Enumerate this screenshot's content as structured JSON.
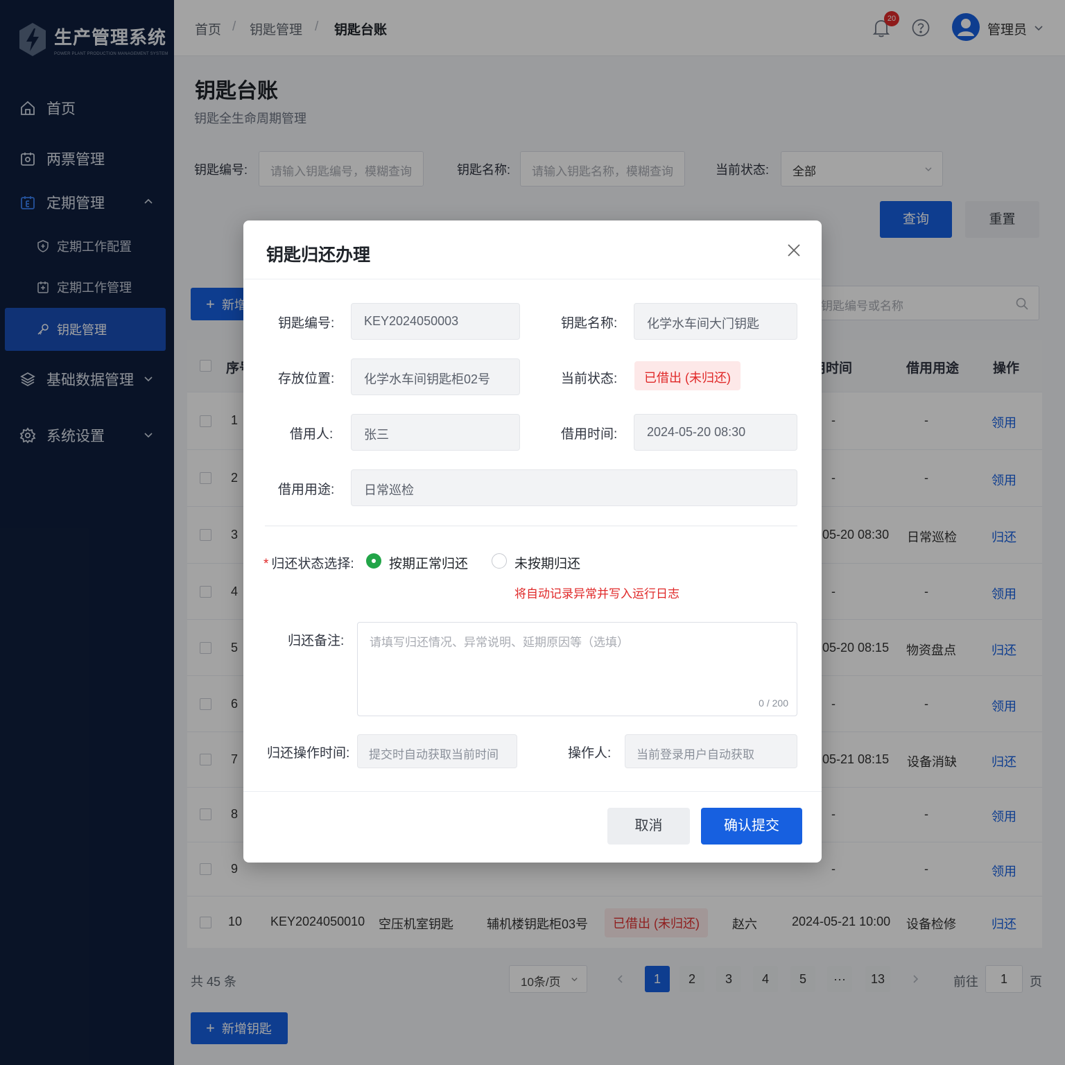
{
  "colors": {
    "sidebar_bg": "#0f1f3d",
    "primary": "#1760e0",
    "danger": "#e02929",
    "success": "#22a548"
  },
  "brand": {
    "title": "生产管理系统",
    "subtitle": "POWER PLANT PRODUCTION MANAGEMENT SYSTEM"
  },
  "sidebar": {
    "items": [
      {
        "label": "首页",
        "icon": "home-icon"
      },
      {
        "label": "两票管理",
        "icon": "ticket-icon"
      },
      {
        "label": "定期管理",
        "icon": "calendar-icon",
        "expanded": true,
        "children": [
          {
            "label": "定期工作配置",
            "icon": "shield-icon"
          },
          {
            "label": "定期工作管理",
            "icon": "calendar-check-icon"
          },
          {
            "label": "钥匙管理",
            "icon": "key-icon",
            "active": true
          }
        ]
      },
      {
        "label": "基础数据管理",
        "icon": "database-icon"
      },
      {
        "label": "系统设置",
        "icon": "gear-icon"
      }
    ]
  },
  "header": {
    "breadcrumb": [
      "首页",
      "钥匙管理",
      "钥匙台账"
    ],
    "separator": "/",
    "notification_count": "20",
    "user_name": "管理员"
  },
  "page": {
    "title": "钥匙台账",
    "subtitle": "钥匙全生命周期管理"
  },
  "filters": {
    "key_no_label": "钥匙编号:",
    "key_no_placeholder": "请输入钥匙编号，模糊查询",
    "key_name_label": "钥匙名称:",
    "key_name_placeholder": "请输入钥匙名称，模糊查询",
    "status_label": "当前状态:",
    "status_value": "全部",
    "query_btn": "查询",
    "reset_btn": "重置"
  },
  "toolbar": {
    "add_label": "新增钥匙",
    "add_label_partial": "新增",
    "search_placeholder": "钥匙编号或名称"
  },
  "table": {
    "headers": {
      "index": "序号",
      "borrow_time": "借用时间",
      "purpose": "借用用途",
      "action": "操作"
    },
    "headers_partial": {
      "index": "序号",
      "borrow_time": "用时间"
    },
    "rows": [
      {
        "index": "1",
        "time": "-",
        "purpose": "-",
        "action": "领用"
      },
      {
        "index": "2",
        "time": "-",
        "purpose": "-",
        "action": "领用"
      },
      {
        "index": "3",
        "time": "05-20 08:30",
        "purpose": "日常巡检",
        "action": "归还"
      },
      {
        "index": "4",
        "time": "-",
        "purpose": "-",
        "action": "领用"
      },
      {
        "index": "5",
        "time": "05-20 08:15",
        "purpose": "物资盘点",
        "action": "归还"
      },
      {
        "index": "6",
        "time": "-",
        "purpose": "-",
        "action": "领用"
      },
      {
        "index": "7",
        "time": "05-21 08:15",
        "purpose": "设备消缺",
        "action": "归还"
      },
      {
        "index": "8",
        "time": "-",
        "purpose": "-",
        "action": "领用"
      },
      {
        "index": "9",
        "time": "-",
        "purpose": "-",
        "action": "领用"
      },
      {
        "index": "10",
        "key_no": "KEY2024050010",
        "name": "空压机室钥匙",
        "location": "辅机楼钥匙柜03号",
        "status": "已借出 (未归还)",
        "borrower": "赵六",
        "time": "2024-05-21 10:00",
        "purpose": "设备检修",
        "action": "归还"
      }
    ]
  },
  "pagination": {
    "total": "共 45 条",
    "page_size": "10条/页",
    "pages": [
      "1",
      "2",
      "3",
      "4",
      "5",
      "···",
      "13"
    ],
    "current": "1",
    "goto_label": "前往",
    "goto_value": "1",
    "page_suffix": "页"
  },
  "modal": {
    "title": "钥匙归还办理",
    "key_no_label": "钥匙编号:",
    "key_no": "KEY2024050003",
    "key_name_label": "钥匙名称:",
    "key_name": "化学水车间大门钥匙",
    "location_label": "存放位置:",
    "location": "化学水车间钥匙柜02号",
    "status_label": "当前状态:",
    "status": "已借出 (未归还)",
    "borrower_label": "借用人:",
    "borrower": "张三",
    "borrow_time_label": "借用时间:",
    "borrow_time": "2024-05-20 08:30",
    "purpose_label": "借用用途:",
    "purpose": "日常巡检",
    "return_status_label": "归还状态选择:",
    "required_mark": "*",
    "option_normal": "按期正常归还",
    "option_overdue": "未按期归还",
    "selected_option": "按期正常归还",
    "hint": "将自动记录异常并写入运行日志",
    "remark_label": "归还备注:",
    "remark_placeholder": "请填写归还情况、异常说明、延期原因等（选填）",
    "remark_count": "0 / 200",
    "op_time_label": "归还操作时间:",
    "op_time_placeholder": "提交时自动获取当前时间",
    "operator_label": "操作人:",
    "operator_placeholder": "当前登录用户自动获取",
    "cancel_btn": "取消",
    "submit_btn": "确认提交"
  }
}
